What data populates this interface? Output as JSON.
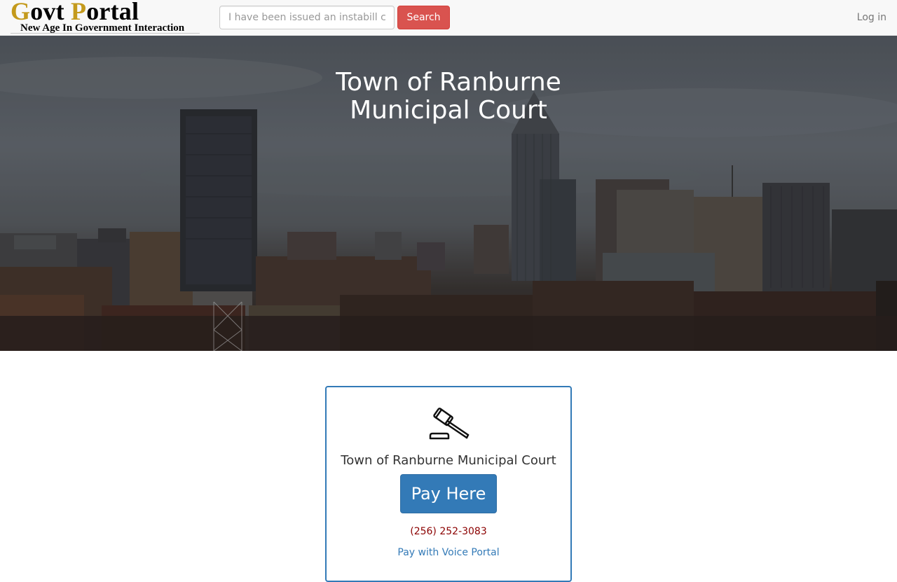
{
  "navbar": {
    "brand_first_letter": "G",
    "brand_rest_1": "ovt ",
    "brand_second_letter": "P",
    "brand_rest_2": "ortal",
    "tagline": "New Age In Government Interaction",
    "search_placeholder": "I have been issued an instabill citation",
    "search_button_label": "Search",
    "login_label": "Log in"
  },
  "hero": {
    "title_line1": "Town of Ranburne",
    "title_line2": "Municipal Court"
  },
  "card": {
    "icon": "gavel-icon",
    "court_name": "Town of Ranburne Municipal Court",
    "pay_button_label": "Pay Here",
    "phone": "(256) 252-3083",
    "voice_link_label": "Pay with Voice Portal"
  },
  "colors": {
    "brand_accent": "#c49a1c",
    "search_button": "#d9534f",
    "primary": "#337ab7",
    "phone_text": "#8b0000"
  }
}
